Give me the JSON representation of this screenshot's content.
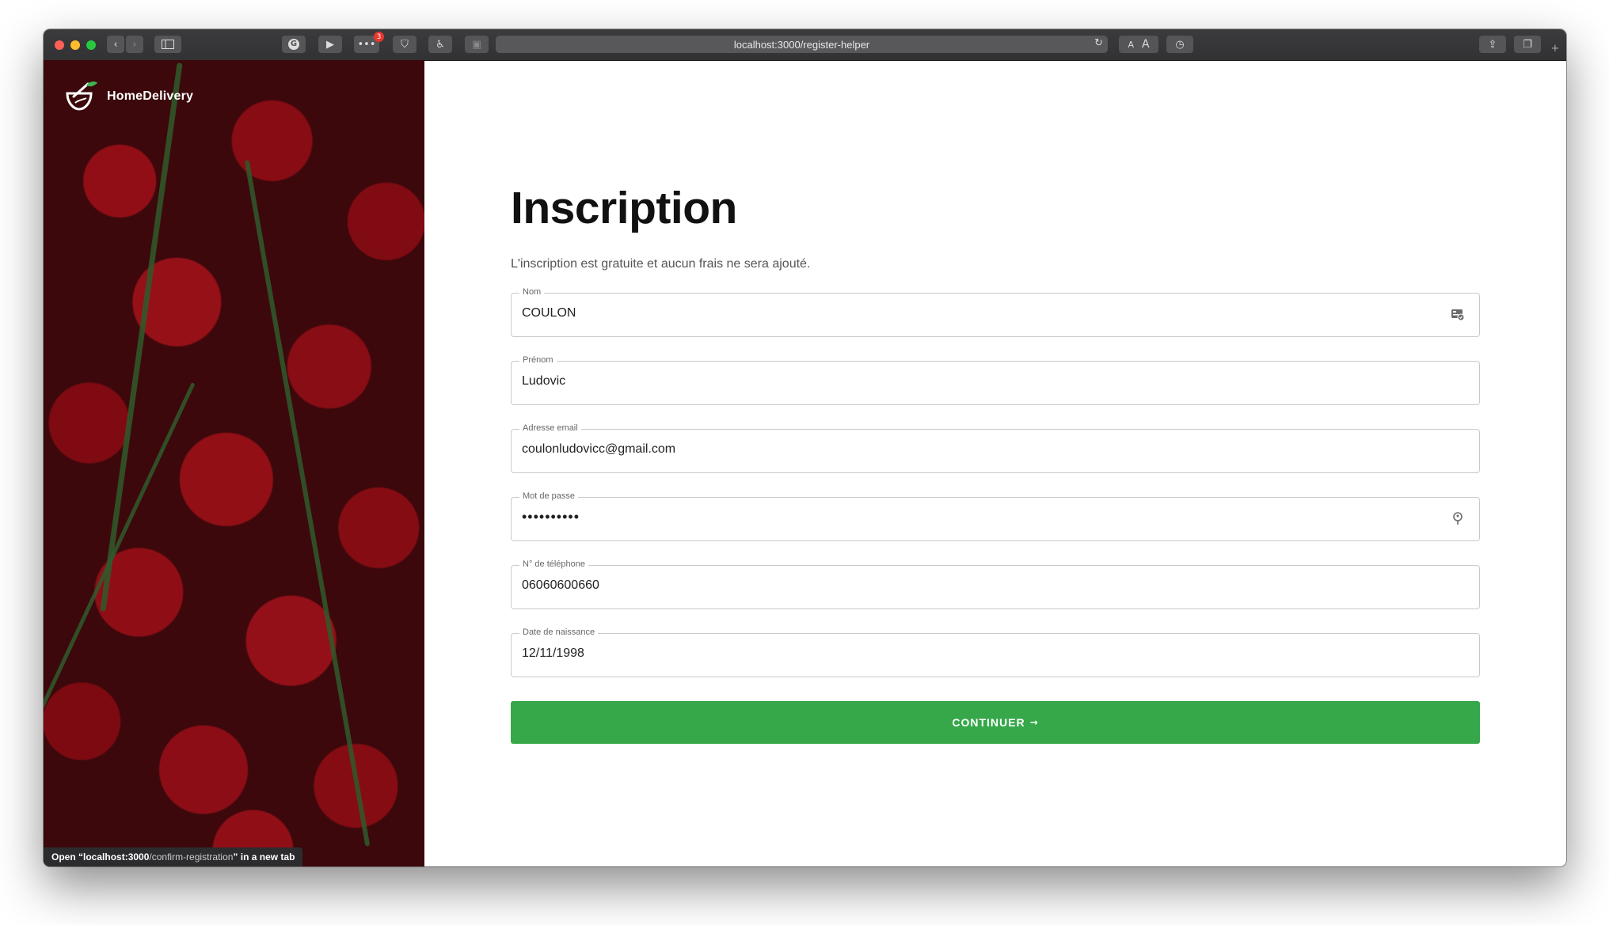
{
  "browser": {
    "url": "localhost:3000/register-helper",
    "extension_badge": "3",
    "reader_small": "A",
    "reader_large": "A"
  },
  "brand": {
    "name": "HomeDelivery"
  },
  "status_bar": {
    "prefix": "Open “",
    "host": "localhost:3000",
    "path": "/confirm-registration",
    "suffix": "” in a new tab"
  },
  "form": {
    "title": "Inscription",
    "subtitle": "L'inscription est gratuite et aucun frais ne sera ajouté.",
    "fields": [
      {
        "label": "Nom",
        "value": "COULON",
        "icon": "contact-card-icon"
      },
      {
        "label": "Prénom",
        "value": "Ludovic"
      },
      {
        "label": "Adresse email",
        "value": "coulonludovicc@gmail.com"
      },
      {
        "label": "Mot de passe",
        "value": "••••••••••",
        "icon": "password-key-icon"
      },
      {
        "label": "N° de téléphone",
        "value": "06060600660"
      },
      {
        "label": "Date de naissance",
        "value": "12/11/1998"
      }
    ],
    "submit_label": "CONTINUER",
    "submit_arrow": "→"
  },
  "colors": {
    "accent": "#36a84a"
  }
}
